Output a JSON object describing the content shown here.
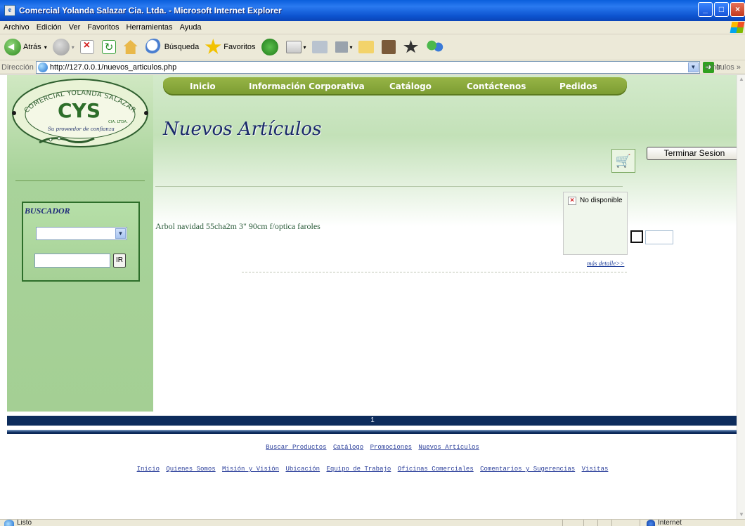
{
  "window": {
    "title": "Comercial Yolanda Salazar Cia. Ltda. - Microsoft Internet Explorer",
    "app_icon": "ie-page-icon",
    "controls": [
      "minimize",
      "maximize",
      "close"
    ]
  },
  "menubar": {
    "items": [
      "Archivo",
      "Edición",
      "Ver",
      "Favoritos",
      "Herramientas",
      "Ayuda"
    ]
  },
  "toolbar": {
    "back_label": "Atrás",
    "search_label": "Búsqueda",
    "favorites_label": "Favoritos"
  },
  "addressbar": {
    "label": "Dirección",
    "url": "http://127.0.0.1/nuevos_articulos.php",
    "go_label": "Ir",
    "links_label": "Vínculos"
  },
  "logo": {
    "ring_text": "COMERCIAL YOLANDA SALAZAR",
    "monogram": "CYS",
    "sub": "CIA. LTDA.",
    "tagline": "Su proveedor de confianza"
  },
  "nav": {
    "items": [
      "Inicio",
      "Información Corporativa",
      "Catálogo",
      "Contáctenos",
      "Pedidos"
    ]
  },
  "page": {
    "title": "Nuevos Artículos",
    "logout_label": "Terminar Sesion"
  },
  "buscador": {
    "title": "BUSCADOR",
    "select_value": "",
    "input_value": "",
    "button_label": "IR"
  },
  "product": {
    "name": "Arbol navidad 55cha2m 3\" 90cm f/optica faroles",
    "image_alt": "No disponible",
    "more_link": "más detalle>>",
    "qty_value": ""
  },
  "pager": {
    "current": "1"
  },
  "footer": {
    "row1": [
      "Buscar Productos",
      "Catálogo",
      "Promociones",
      "Nuevos Artículos"
    ],
    "row2": [
      "Inicio",
      "Quienes Somos",
      "Misión y Visión",
      "Ubicación",
      "Equipo de Trabajo",
      "Oficinas Comerciales",
      "Comentarios y Sugerencias",
      "Visitas"
    ]
  },
  "statusbar": {
    "status": "Listo",
    "zone": "Internet"
  },
  "colors": {
    "nav_bg": "#86a53a",
    "left_bg": "#a8d39a",
    "title": "#1a2a6a",
    "pager_bg": "#0d2c5c",
    "link": "#2a3e9a"
  }
}
